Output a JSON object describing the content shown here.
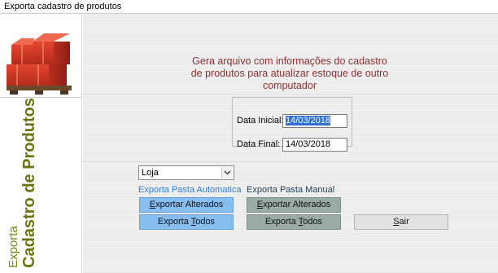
{
  "window": {
    "title": "Exporta cadastro de produtos"
  },
  "sidebar": {
    "label_small": "Exporta",
    "label_big": "Cadastro de Produtos",
    "icon": "boxes-icon"
  },
  "heading": "Gera arquivo com informações do cadastro de produtos para atualizar estoque de outro computador",
  "dates": {
    "initial_label": "Data Inicial:",
    "initial_value": "14/03/2018",
    "final_label": "Data Final:",
    "final_value": "14/03/2018"
  },
  "store_select": {
    "value": "Loja"
  },
  "auto_section": {
    "label": "Exporta Pasta Automatica",
    "altered_button": {
      "prefix": "",
      "mnemonic": "E",
      "rest": "xportar Alterados"
    },
    "all_button": {
      "prefix": "Exporta ",
      "mnemonic": "T",
      "rest": "odos"
    }
  },
  "manual_section": {
    "label": "Exporta Pasta Manual",
    "altered_button": {
      "prefix": "",
      "mnemonic": "E",
      "rest": "xportar Alterados"
    },
    "all_button": {
      "prefix": "Exporta ",
      "mnemonic": "T",
      "rest": "odos"
    }
  },
  "exit_button": {
    "prefix": "",
    "mnemonic": "S",
    "rest": "air"
  },
  "colors": {
    "heading": "#8a3030",
    "sidebar_text": "#6b7410",
    "auto_buttons": "#88bdf0",
    "manual_buttons": "#9aaba6",
    "auto_label": "#2f7ed8",
    "manual_label": "#1d3d5c",
    "date_highlight": "#3071d6"
  }
}
